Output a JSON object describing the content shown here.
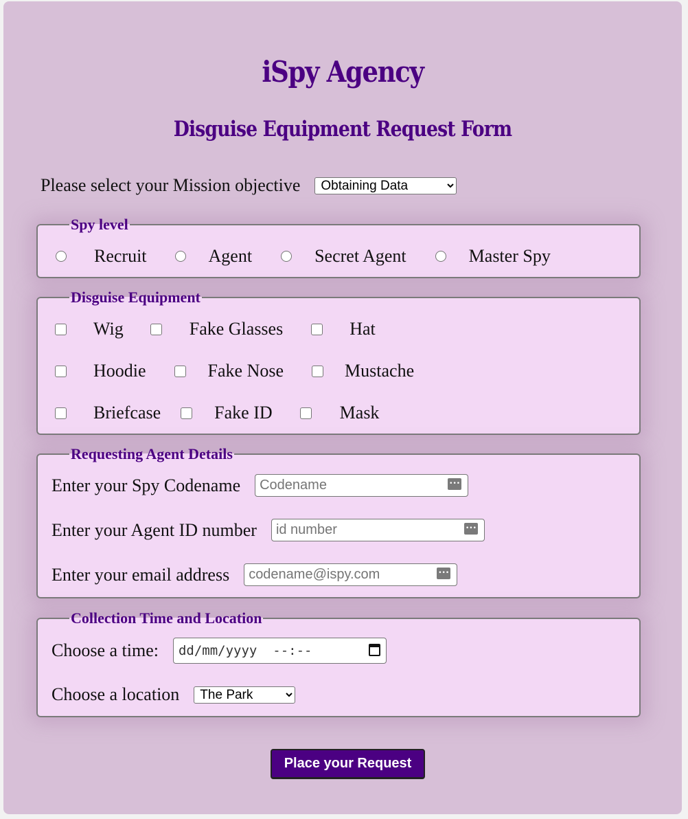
{
  "header": {
    "title": "iSpy Agency",
    "subtitle": "Disguise Equipment Request Form"
  },
  "mission": {
    "label": "Please select your Mission objective",
    "selected": "Obtaining Data"
  },
  "spy_level": {
    "legend": "Spy level",
    "options": [
      "Recruit",
      "Agent",
      "Secret Agent",
      "Master Spy"
    ]
  },
  "equipment": {
    "legend": "Disguise Equipment",
    "items": [
      "Wig",
      "Fake Glasses",
      "Hat",
      "Hoodie",
      "Fake Nose",
      "Mustache",
      "Briefcase",
      "Fake ID",
      "Mask"
    ]
  },
  "agent_details": {
    "legend": "Requesting Agent Details",
    "fields": [
      {
        "label": "Enter your Spy Codename",
        "placeholder": "Codename"
      },
      {
        "label": "Enter your Agent ID number",
        "placeholder": "id number"
      },
      {
        "label": "Enter your email address",
        "placeholder": "codename@ispy.com"
      }
    ]
  },
  "collection": {
    "legend": "Collection Time and Location",
    "time_label": "Choose a time:",
    "time_placeholder": "dd/mm/yyyy  --:--",
    "location_label": "Choose a location",
    "location_selected": "The Park"
  },
  "submit_label": "Place your Request",
  "colors": {
    "brand": "#4b0082",
    "page_bg": "#d7bfd7",
    "fieldset_bg": "#f3d8f5"
  }
}
